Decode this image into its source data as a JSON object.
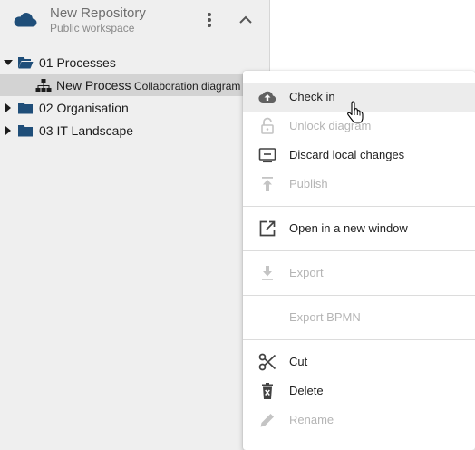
{
  "repository": {
    "title": "New Repository",
    "subtitle": "Public workspace",
    "icon": "cloud-icon",
    "accent_color": "#1f4e79"
  },
  "tree": {
    "items": [
      {
        "label": "01 Processes",
        "expanded": true
      },
      {
        "label": "New Process",
        "type_label": "Collaboration diagram ...",
        "selected": true
      },
      {
        "label": "02 Organisation",
        "expanded": false
      },
      {
        "label": "03 IT Landscape",
        "expanded": false
      }
    ]
  },
  "context_menu": {
    "items": [
      {
        "label": "Check in",
        "icon": "cloud-upload-icon",
        "enabled": true,
        "hovered": true
      },
      {
        "label": "Unlock diagram",
        "icon": "lock-open-icon",
        "enabled": false
      },
      {
        "label": "Discard local changes",
        "icon": "discard-icon",
        "enabled": true
      },
      {
        "label": "Publish",
        "icon": "publish-icon",
        "enabled": false
      },
      {
        "label": "Open in a new window",
        "icon": "open-new-window-icon",
        "enabled": true
      },
      {
        "label": "Export",
        "icon": "export-icon",
        "enabled": false
      },
      {
        "label": "Export BPMN",
        "icon": "",
        "enabled": false
      },
      {
        "label": "Cut",
        "icon": "scissors-icon",
        "enabled": true
      },
      {
        "label": "Delete",
        "icon": "trash-icon",
        "enabled": true
      },
      {
        "label": "Rename",
        "icon": "pencil-icon",
        "enabled": false
      }
    ]
  },
  "colors": {
    "enabled_text": "#212121",
    "disabled_text": "#b5b5b5",
    "folder": "#1f4e79"
  }
}
